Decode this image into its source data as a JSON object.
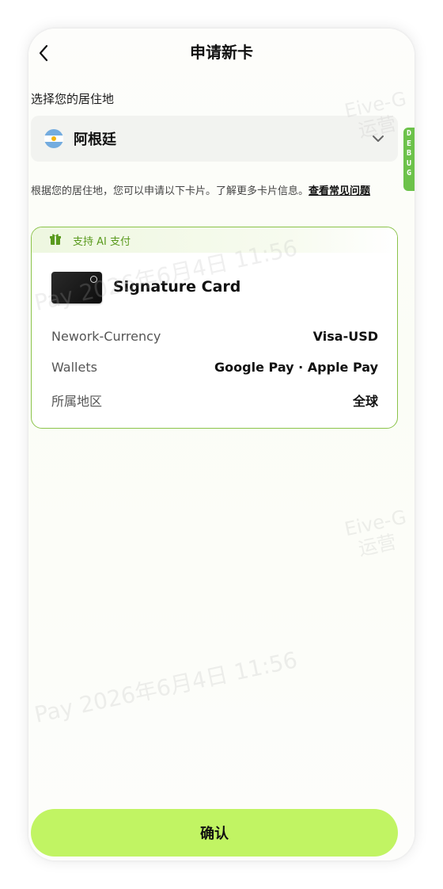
{
  "header": {
    "title": "申请新卡"
  },
  "residence": {
    "label": "选择您的居住地",
    "selected_country": "阿根廷"
  },
  "debug_tab": {
    "letters": [
      "D",
      "E",
      "B",
      "U",
      "G"
    ]
  },
  "info": {
    "text": "根据您的居住地，您可以申请以下卡片。了解更多卡片信息。",
    "link": "查看常见问题"
  },
  "card": {
    "banner_label": "支持 AI 支付",
    "name": "Signature Card",
    "rows": [
      {
        "key": "Nework-Currency",
        "value": "Visa-USD"
      },
      {
        "key": "Wallets",
        "value": "Google Pay · Apple Pay"
      },
      {
        "key": "所属地区",
        "value": "全球"
      }
    ]
  },
  "watermarks": {
    "time_mark": "Pay 2026年6月4日 11:56",
    "op_mark_line1": "Eive-G",
    "op_mark_line2": "运营"
  },
  "footer": {
    "confirm_label": "确认"
  },
  "colors": {
    "accent": "#c1f463",
    "card_border": "#8bc34a",
    "banner_text": "#5a9a1e",
    "debug": "#6cc24a"
  },
  "icons": {
    "back": "chevron-left-icon",
    "dropdown": "chevron-down-icon",
    "gift": "gift-icon",
    "flag": "argentina-flag-icon"
  }
}
